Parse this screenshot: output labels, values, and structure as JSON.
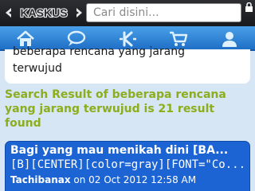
{
  "header": {
    "logo_text": "KASKUS",
    "search_placeholder": "Cari disini..."
  },
  "nav": {
    "items": [
      {
        "icon": "home-icon"
      },
      {
        "icon": "chat-icon"
      },
      {
        "icon": "kaskus-k-icon"
      },
      {
        "icon": "cart-icon"
      },
      {
        "icon": "user-icon"
      }
    ]
  },
  "previous_item": {
    "line1": "beberapa rencana yang jarang",
    "line2": "terwujud"
  },
  "result": {
    "text": "Search Result of beberapa rencana yang jarang terwujud is 21 result found"
  },
  "thread": {
    "title": "Bagi yang mau menikah dini [BA...",
    "snippet": "[B][CENTER][color=gray][FONT=\"Co...",
    "author": "Tachibanax",
    "date_text": " on 02 Oct 2012 12:58 AM"
  },
  "colors": {
    "accent_blue": "#1c64d4",
    "result_green": "#8cad1d"
  }
}
